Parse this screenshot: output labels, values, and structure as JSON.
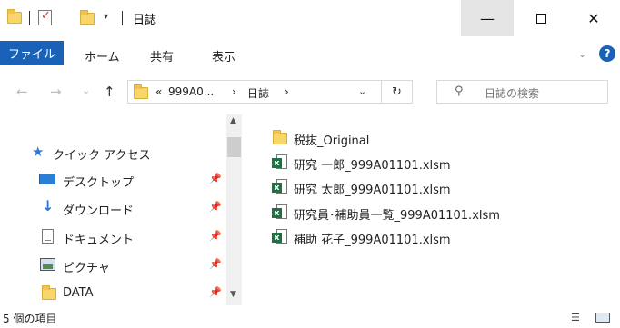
{
  "titlebar": {
    "title": "日誌",
    "separator": "|",
    "check_mark": "✓",
    "dropdown_arrow": "▾",
    "minimize_glyph": "—",
    "close_glyph": "✕"
  },
  "ribbon": {
    "tabs": [
      "ファイル",
      "ホーム",
      "共有",
      "表示"
    ],
    "expand_glyph": "⌄",
    "help_glyph": "?"
  },
  "nav": {
    "back_glyph": "←",
    "forward_glyph": "→",
    "recent_glyph": "⌄",
    "up_glyph": "↑",
    "address": {
      "overflow": "«",
      "segments": [
        "999A0...",
        "日誌"
      ],
      "separator": "›",
      "dropdown_glyph": "⌄"
    },
    "refresh_glyph": "↻",
    "search_placeholder": "日誌の検索",
    "search_glyph": "⚲"
  },
  "navpane": {
    "quick_access": "クイック アクセス",
    "pin_glyph": "📌",
    "items": [
      "デスクトップ",
      "ダウンロード",
      "ドキュメント",
      "ピクチャ",
      "DATA"
    ]
  },
  "scrollbar": {
    "up_glyph": "▲",
    "down_glyph": "▼"
  },
  "files": [
    {
      "name": "税抜_Original",
      "type": "folder"
    },
    {
      "name": "研究 一郎_999A01101.xlsm",
      "type": "excel"
    },
    {
      "name": "研究 太郎_999A01101.xlsm",
      "type": "excel"
    },
    {
      "name": "研究員･補助員一覧_999A01101.xlsm",
      "type": "excel"
    },
    {
      "name": "補助 花子_999A01101.xlsm",
      "type": "excel"
    }
  ],
  "excel_glyph": "x",
  "status": {
    "item_count": "5 個の項目",
    "details_glyph": "☰"
  },
  "colors": {
    "accent": "#1a62b8",
    "folder": "#f8d66a",
    "excel": "#1f7244"
  }
}
